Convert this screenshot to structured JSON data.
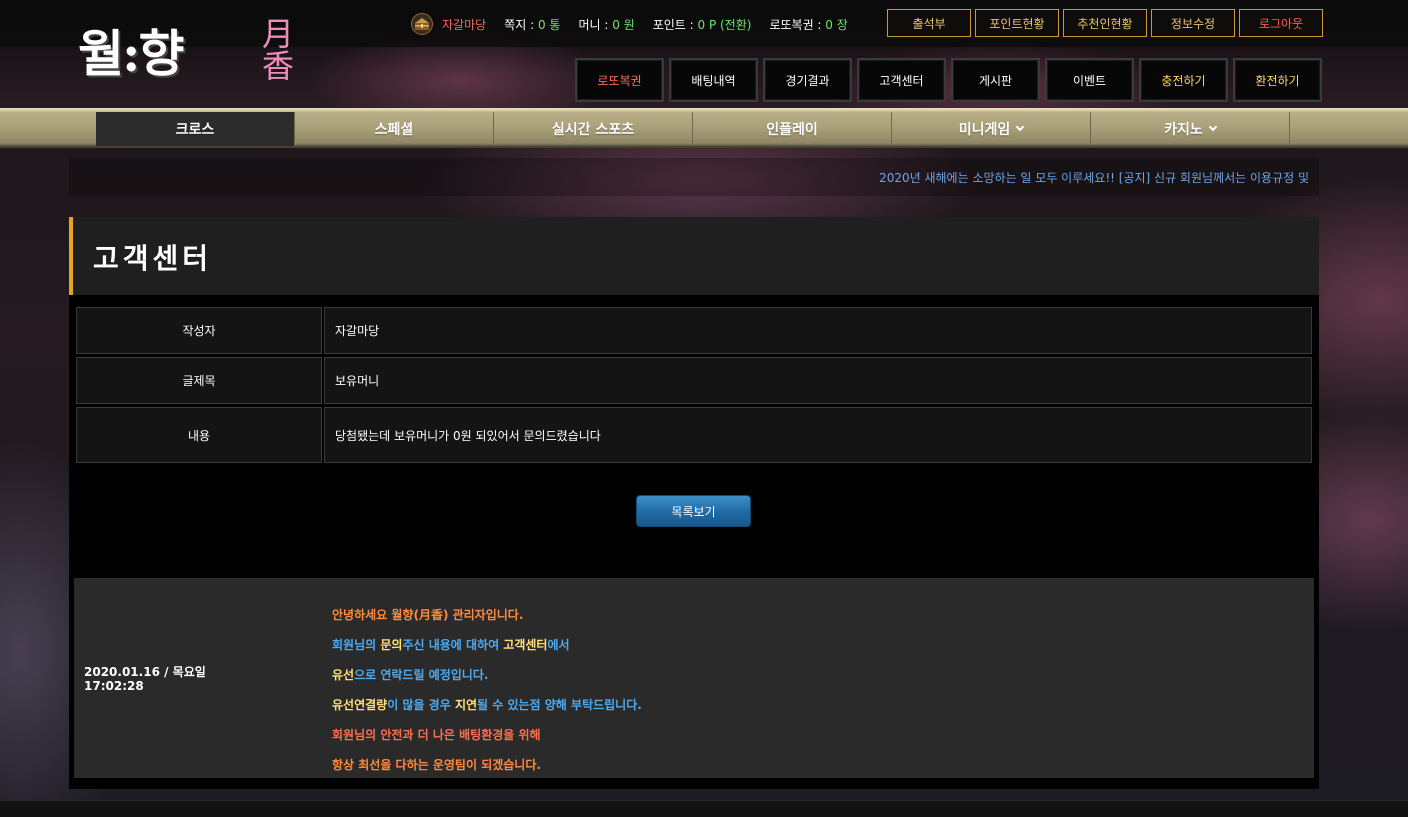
{
  "logo": {
    "main": "월:향",
    "sub_top": "月",
    "sub_bottom": "香"
  },
  "user": {
    "icon": "treasure-chest-icon",
    "name": "자갈마당",
    "note_label": "쪽지 : ",
    "note_value": "0 통",
    "money_label": "머니 : ",
    "money_value": "0 원",
    "point_label": "포인트 : ",
    "point_value": "0 P (전환)",
    "lotto_label": "로또복권 : ",
    "lotto_value": "0 장"
  },
  "top_buttons": {
    "attendance": "출석부",
    "point_status": "포인트현황",
    "referral_status": "추천인현황",
    "edit_info": "정보수정",
    "logout": "로그아웃"
  },
  "main_menu": {
    "lotto": "로또복권",
    "bet_history": "배팅내역",
    "results": "경기결과",
    "customer_center": "고객센터",
    "board": "게시판",
    "event": "이벤트",
    "deposit": "충전하기",
    "withdraw": "환전하기"
  },
  "nav": {
    "cross": "크로스",
    "special": "스페셜",
    "live_sports": "실시간 스포츠",
    "inplay": "인플레이",
    "minigame": "미니게임",
    "casino": "카지노"
  },
  "ticker": {
    "text": "2020년 새해에는 소망하는 일 모두 이루세요!! [공지] 신규 회원님께서는 이용규정 및"
  },
  "page": {
    "title": "고객센터"
  },
  "form": {
    "author_label": "작성자",
    "author_value": "자갈마당",
    "subject_label": "글제목",
    "subject_value": "보유머니",
    "content_label": "내용",
    "content_value": "당첨됐는데 보유머니가 0원 되있어서 문의드렸습니다"
  },
  "buttons": {
    "list": "목록보기"
  },
  "reply": {
    "date": "2020.01.16 / 목요일",
    "time": "17:02:28",
    "line1": "안녕하세요 월향(月香) 관리자입니다.",
    "line2_a": "회원님의 ",
    "line2_b": "문의",
    "line2_c": "주신 내용에 대하여 ",
    "line2_d": "고객센터",
    "line2_e": "에서",
    "line3_a": "유선",
    "line3_b": "으로 연락드릴 예정입니다.",
    "line4_a": "유선연결량",
    "line4_b": "이 많을 경우 ",
    "line4_c": "지연",
    "line4_d": "될 수 있는점 양해 부탁드립니다.",
    "line5": "회원님의 안전과 더 나은 배팅환경을 위해",
    "line6": "항상 최선을 다하는 운영팀이 되겠습니다."
  },
  "colors": {
    "accent_gold": "#e5a61f",
    "money_green": "#6fe36a",
    "user_red": "#f36a5d",
    "button_blue": "#1f6aa3"
  }
}
